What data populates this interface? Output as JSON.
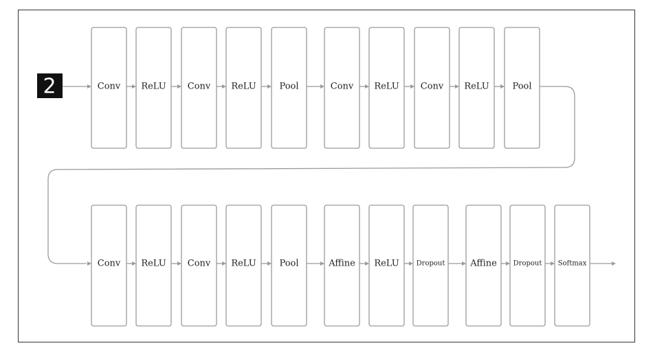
{
  "input_image": {
    "digit": "2"
  },
  "rows": [
    {
      "layers": [
        "Conv",
        "ReLU",
        "Conv",
        "ReLU",
        "Pool",
        "Conv",
        "ReLU",
        "Conv",
        "ReLU",
        "Pool"
      ]
    },
    {
      "layers": [
        "Conv",
        "ReLU",
        "Conv",
        "ReLU",
        "Pool",
        "Affine",
        "ReLU",
        "Dropout",
        "Affine",
        "Dropout",
        "Softmax"
      ]
    }
  ],
  "colors": {
    "box_stroke": "#9a9a9a",
    "frame": "#333333",
    "input_bg": "#111111"
  }
}
